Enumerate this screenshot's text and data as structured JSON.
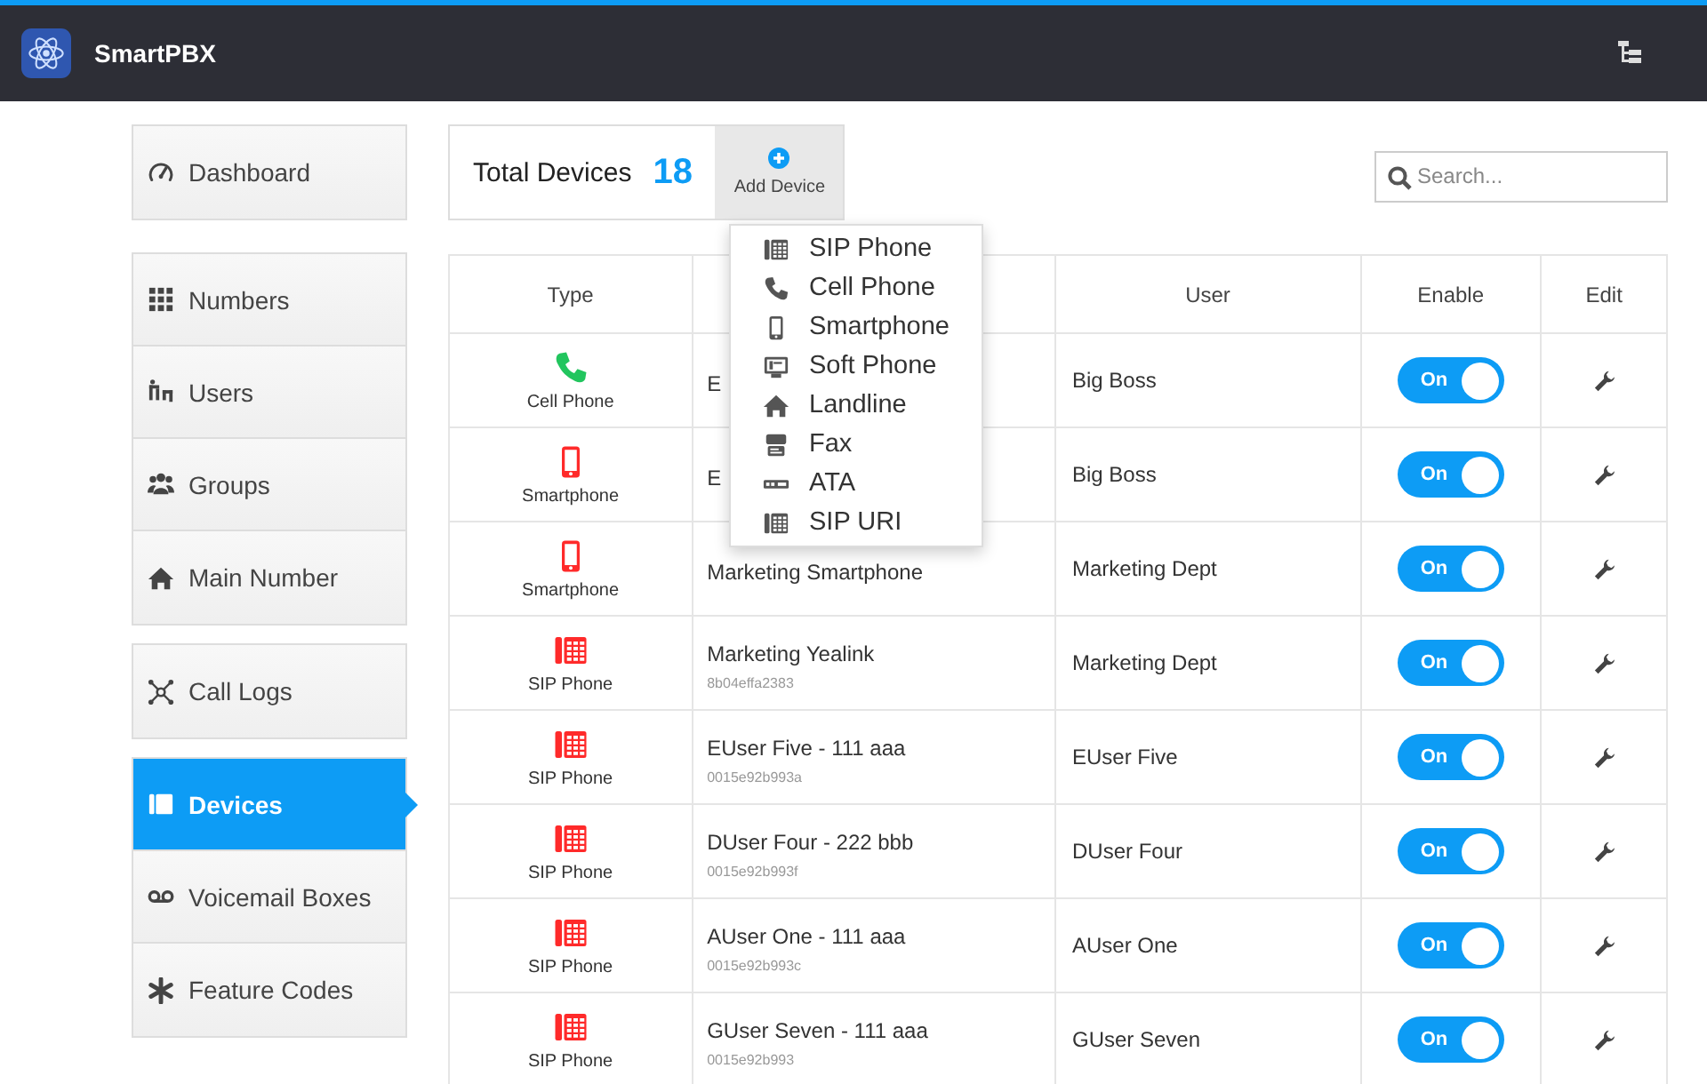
{
  "app": {
    "title": "SmartPBX"
  },
  "sidebar": {
    "groups": [
      [
        {
          "kind": "dashboard",
          "label": "Dashboard",
          "selected": false
        }
      ],
      [
        {
          "kind": "numbers",
          "label": "Numbers",
          "selected": false
        },
        {
          "kind": "users",
          "label": "Users",
          "selected": false
        },
        {
          "kind": "groups",
          "label": "Groups",
          "selected": false
        },
        {
          "kind": "main_number",
          "label": "Main Number",
          "selected": false
        }
      ],
      [
        {
          "kind": "call_logs",
          "label": "Call Logs",
          "selected": false
        }
      ],
      [
        {
          "kind": "devices",
          "label": "Devices",
          "selected": true
        },
        {
          "kind": "voicemail",
          "label": "Voicemail Boxes",
          "selected": false
        },
        {
          "kind": "feature_codes",
          "label": "Feature Codes",
          "selected": false
        }
      ]
    ]
  },
  "summary": {
    "label": "Total Devices",
    "count": "18",
    "add_button": "Add Device"
  },
  "add_menu": {
    "expanded": true,
    "items": [
      {
        "kind": "sip_phone",
        "label": "SIP Phone"
      },
      {
        "kind": "cell_phone",
        "label": "Cell Phone"
      },
      {
        "kind": "smartphone",
        "label": "Smartphone"
      },
      {
        "kind": "soft_phone",
        "label": "Soft Phone"
      },
      {
        "kind": "landline",
        "label": "Landline"
      },
      {
        "kind": "fax",
        "label": "Fax"
      },
      {
        "kind": "ata",
        "label": "ATA"
      },
      {
        "kind": "sip_uri",
        "label": "SIP URI"
      }
    ]
  },
  "search": {
    "placeholder": "Search..."
  },
  "table": {
    "columns": [
      "Type",
      "User",
      "Enable",
      "Edit"
    ],
    "rows": [
      {
        "kind": "cell_phone",
        "color": "#22c55e",
        "type": "Cell Phone",
        "name": "E",
        "user": "Big Boss",
        "enabled": true,
        "enable_label": "On"
      },
      {
        "kind": "smartphone",
        "color": "#ff2a2a",
        "type": "Smartphone",
        "name": "E",
        "user": "Big Boss",
        "enabled": true,
        "enable_label": "On"
      },
      {
        "kind": "smartphone",
        "color": "#ff2a2a",
        "type": "Smartphone",
        "name": "Marketing Smartphone",
        "user": "Marketing Dept",
        "enabled": true,
        "enable_label": "On"
      },
      {
        "kind": "sip_phone",
        "color": "#ff2a2a",
        "type": "SIP Phone",
        "name": "Marketing Yealink",
        "mac": "8b04effa2383",
        "user": "Marketing Dept",
        "enabled": true,
        "enable_label": "On"
      },
      {
        "kind": "sip_phone",
        "color": "#ff2a2a",
        "type": "SIP Phone",
        "name": "EUser Five - 111 aaa",
        "mac": "0015e92b993a",
        "user": "EUser Five",
        "enabled": true,
        "enable_label": "On"
      },
      {
        "kind": "sip_phone",
        "color": "#ff2a2a",
        "type": "SIP Phone",
        "name": "DUser Four - 222 bbb",
        "mac": "0015e92b993f",
        "user": "DUser Four",
        "enabled": true,
        "enable_label": "On"
      },
      {
        "kind": "sip_phone",
        "color": "#ff2a2a",
        "type": "SIP Phone",
        "name": "AUser One - 111 aaa",
        "mac": "0015e92b993c",
        "user": "AUser One",
        "enabled": true,
        "enable_label": "On"
      },
      {
        "kind": "sip_phone",
        "color": "#ff2a2a",
        "type": "SIP Phone",
        "name": "GUser Seven - 111 aaa",
        "mac": "0015e92b993",
        "user": "GUser Seven",
        "enabled": true,
        "enable_label": "On"
      }
    ]
  }
}
